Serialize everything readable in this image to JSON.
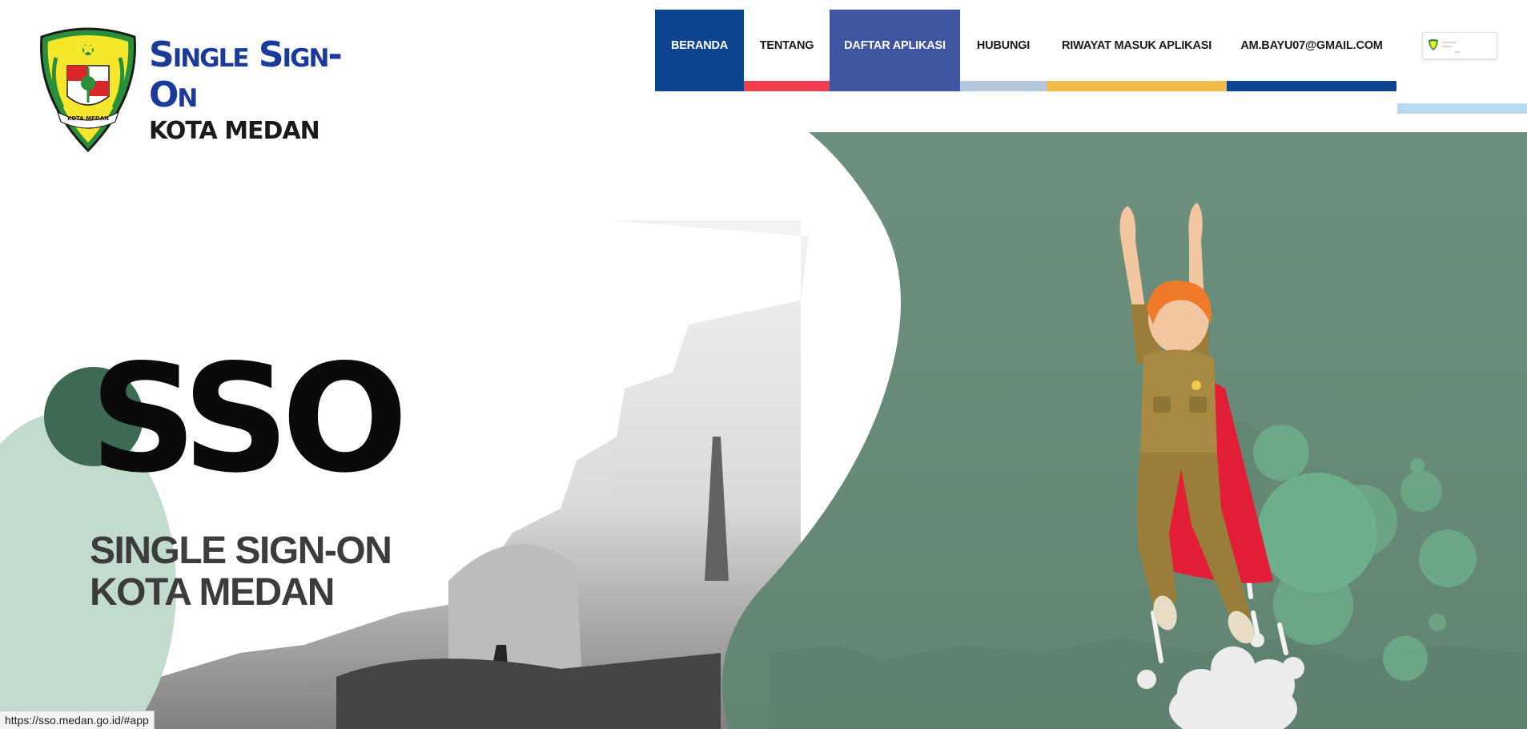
{
  "brand": {
    "title": "Single Sign-On",
    "subtitle": "KOTA MEDAN",
    "emblem_label": "KOTA MEDAN"
  },
  "nav": {
    "items": [
      {
        "label": "BERANDA",
        "color": "#0d4592"
      },
      {
        "label": "TENTANG",
        "color": "#ee3f4e"
      },
      {
        "label": "DAFTAR APLIKASI",
        "color": "#3f55a0"
      },
      {
        "label": "HUBUNGI",
        "color": "#b7c8dc"
      },
      {
        "label": "RIWAYAT MASUK APLIKASI",
        "color": "#f2b94b"
      },
      {
        "label": "AM.BAYU07@GMAIL.COM",
        "color": "#0d4592"
      }
    ]
  },
  "hero": {
    "title": "SSO",
    "subtitle_line1": "SINGLE SIGN-ON",
    "subtitle_line2": "KOTA MEDAN",
    "accent_green": "#6d8f7d",
    "dark_green": "#3e6a54",
    "light_green": "#c1dccd"
  },
  "status_bar": {
    "url": "https://sso.medan.go.id/#app"
  }
}
